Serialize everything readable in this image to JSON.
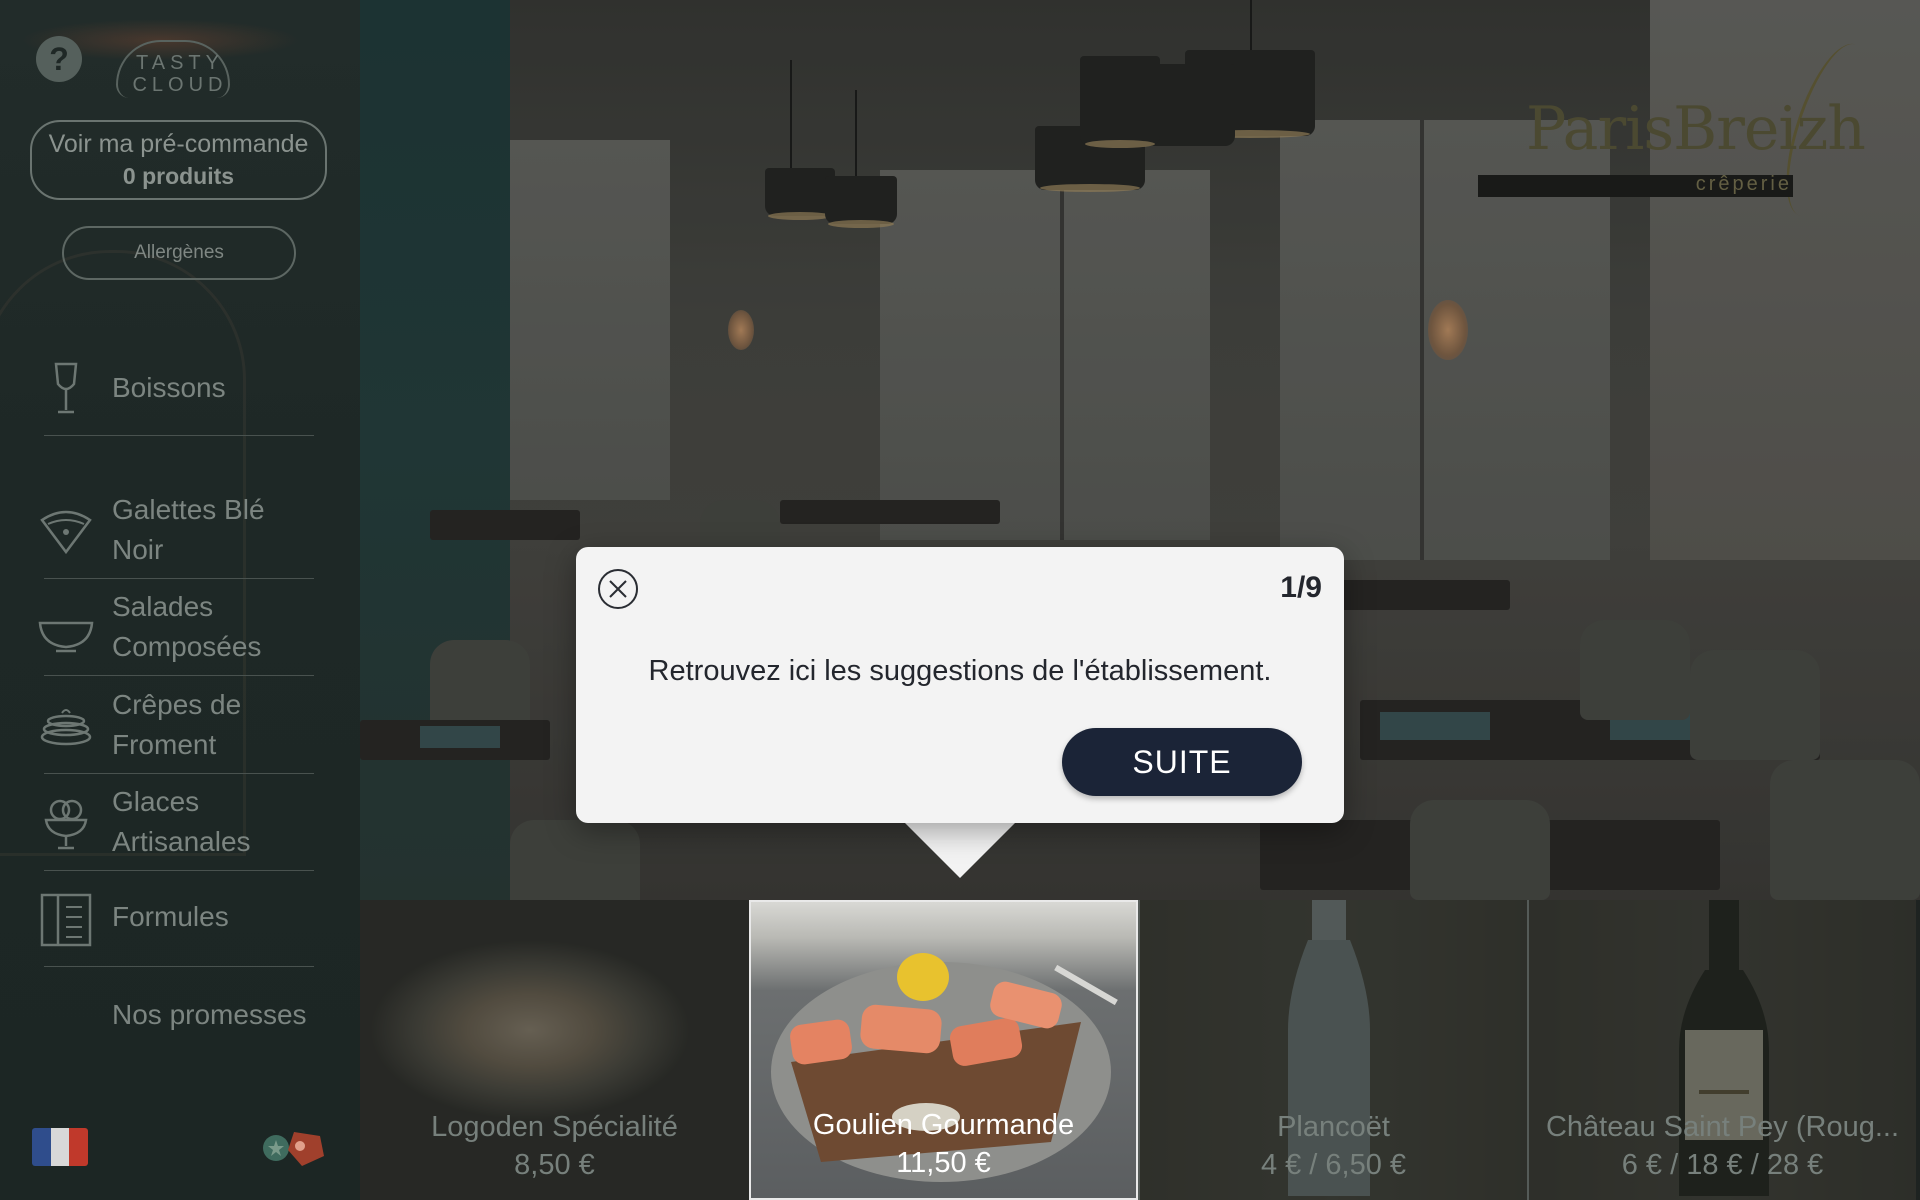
{
  "sidebar": {
    "brand_line1": "TASTY",
    "brand_line2": "CLOUD",
    "help_label": "?",
    "preorder": {
      "line1": "Voir ma pré-commande",
      "line2": "0 produits"
    },
    "allergens_label": "Allergènes",
    "categories": [
      {
        "label": "Boissons",
        "icon": "wine-glass-icon"
      },
      {
        "label": "Galettes Blé Noir",
        "icon": "galette-icon"
      },
      {
        "label": "Salades Composées",
        "icon": "salad-bowl-icon"
      },
      {
        "label": "Crêpes de Froment",
        "icon": "crepe-stack-icon"
      },
      {
        "label": "Glaces Artisanales",
        "icon": "ice-cream-cup-icon"
      },
      {
        "label": "Formules",
        "icon": "menu-book-icon"
      },
      {
        "label": "Nos promesses",
        "icon": ""
      }
    ],
    "language_flag": "flag-fr-icon",
    "promo_icon": "loyalty-tags-icon"
  },
  "restaurant": {
    "name": "ParisBreizh",
    "subtitle": "crêperie"
  },
  "popup": {
    "counter": "1/9",
    "message": "Retrouvez ici les suggestions de l'établissement.",
    "next_label": "SUITE"
  },
  "products": [
    {
      "name": "Logoden Spécialité",
      "price": "8,50 €",
      "highlighted": false
    },
    {
      "name": "Goulien Gourmande",
      "price": "11,50 €",
      "highlighted": true
    },
    {
      "name": "Plancoët",
      "price": "4 € / 6,50 €",
      "highlighted": false
    },
    {
      "name": "Château Saint Pey (Roug...",
      "price": "6 € / 18 € / 28 €",
      "highlighted": false
    }
  ],
  "colors": {
    "sidebar_bg": "#1d2725",
    "popup_bg": "#f3f3f3",
    "primary_button": "#1b2437"
  }
}
